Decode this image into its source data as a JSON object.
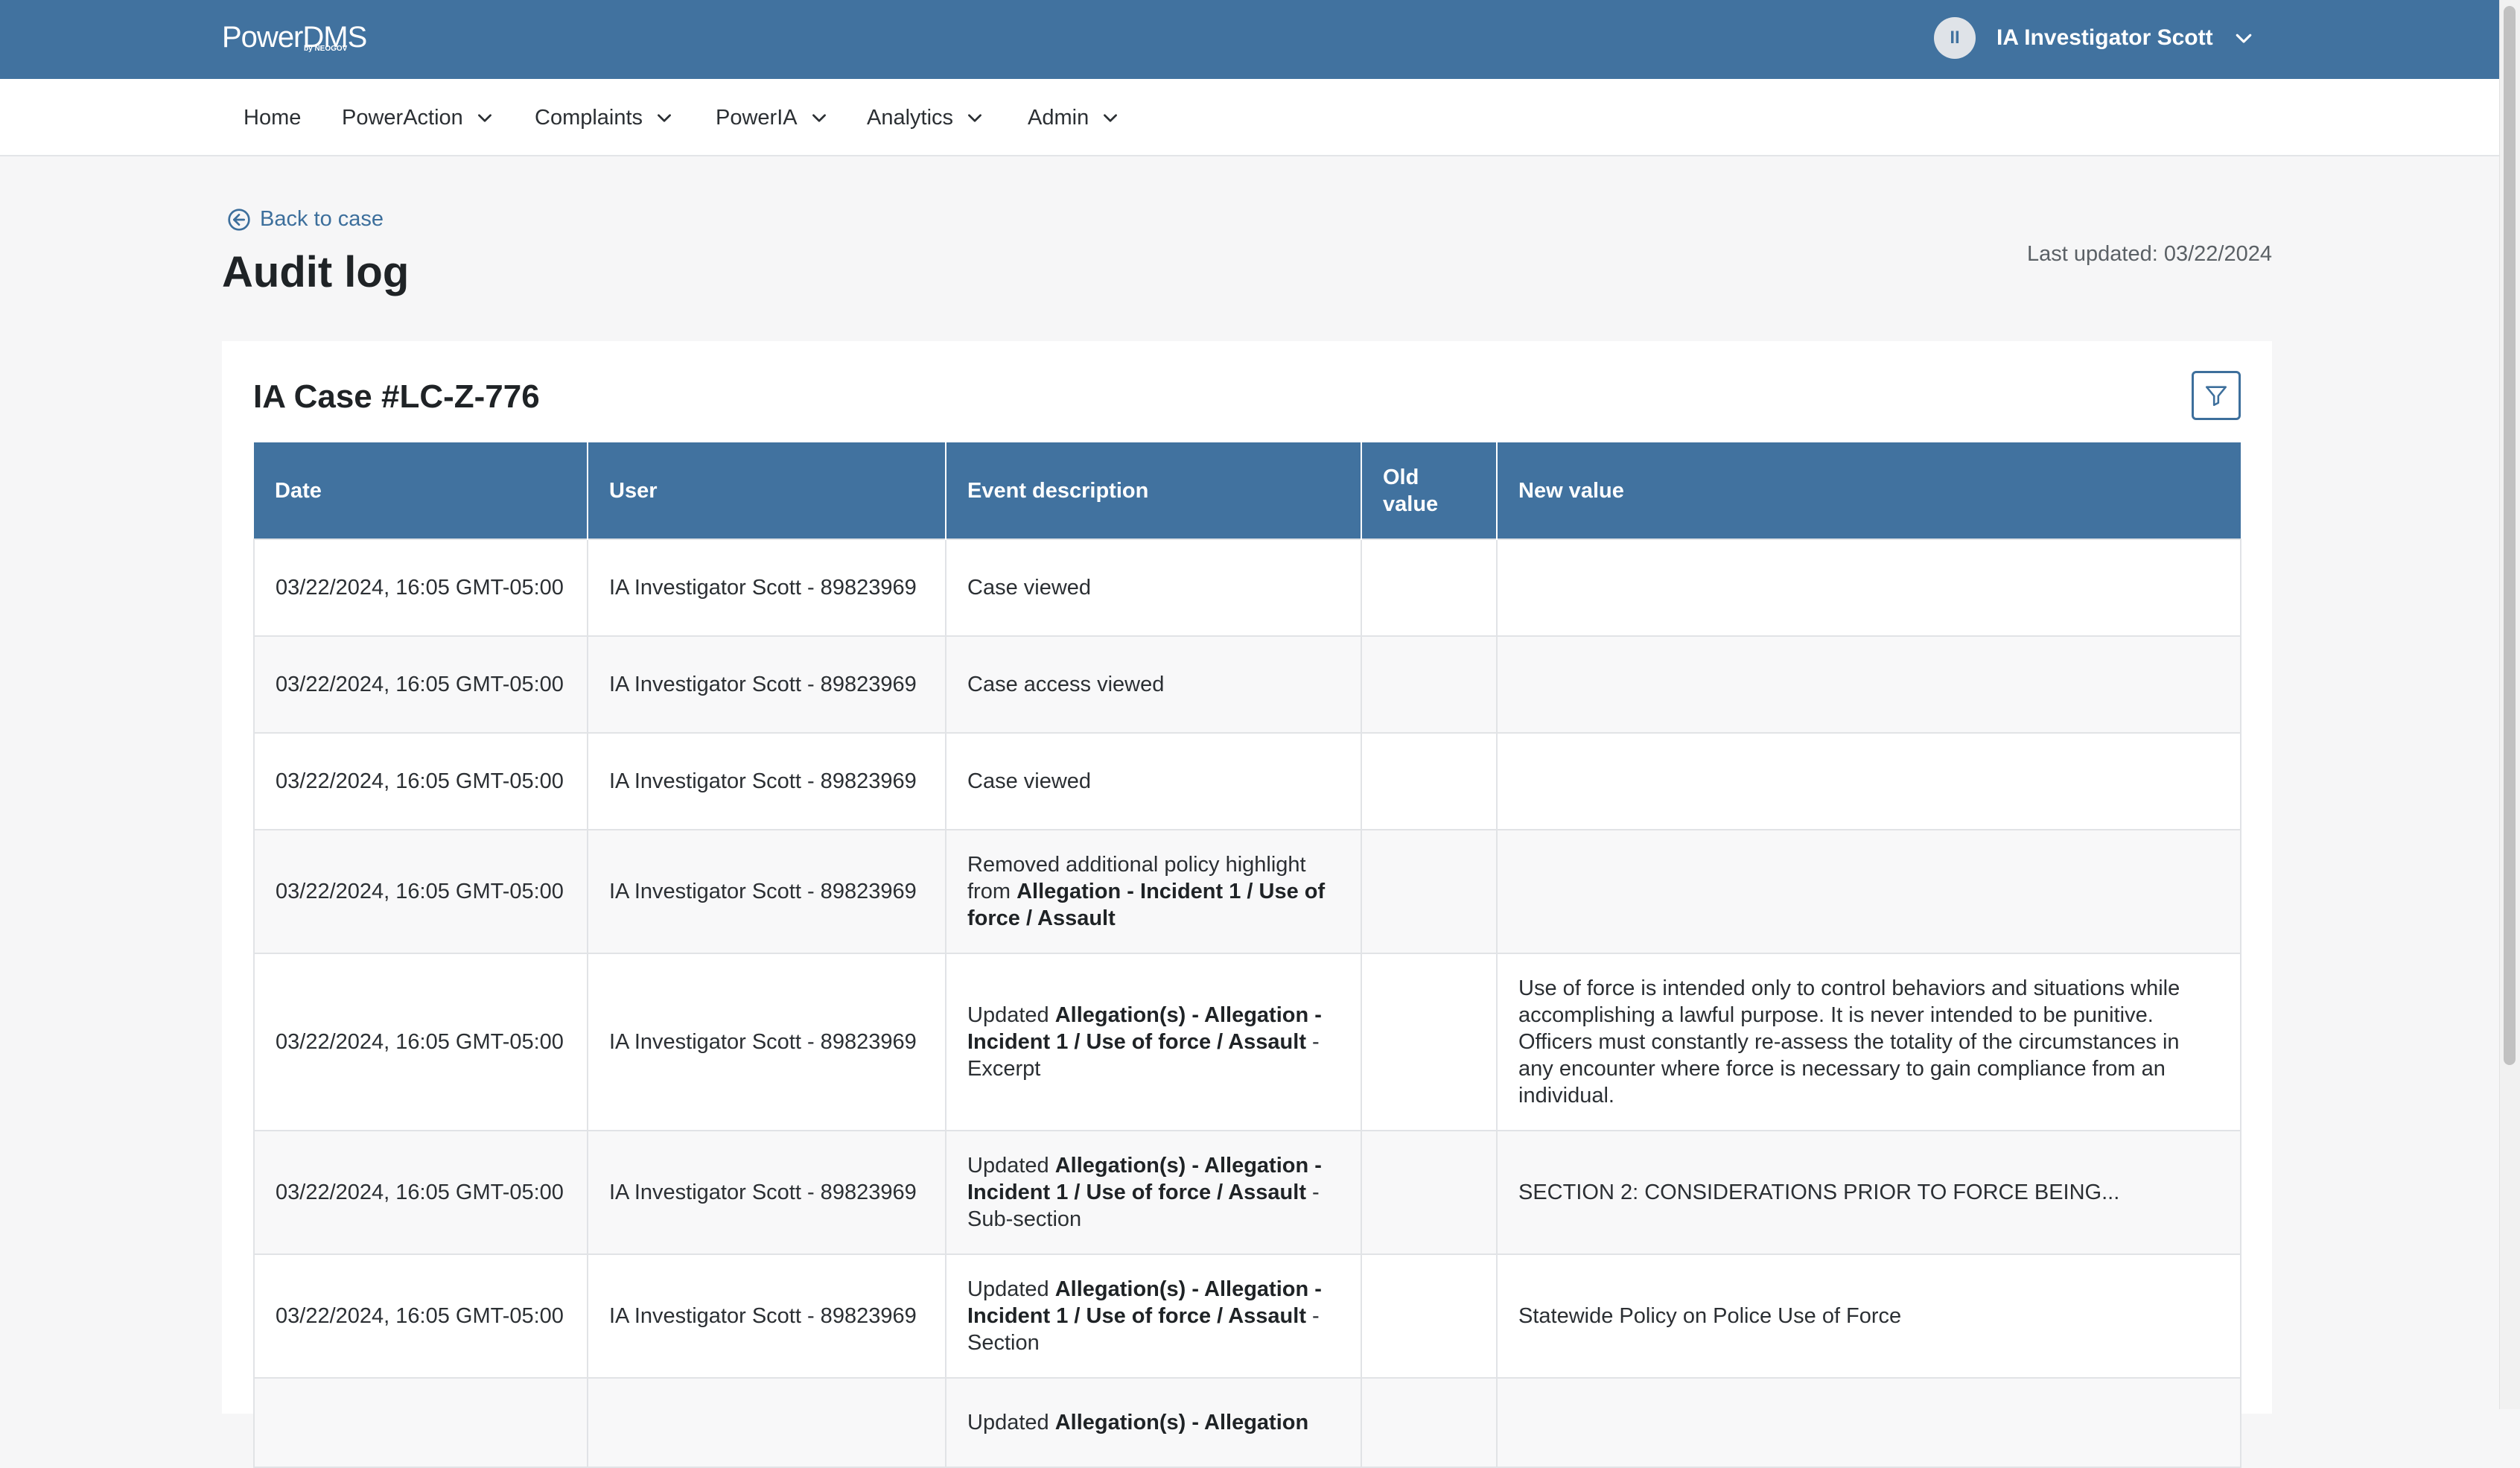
{
  "header": {
    "logo_text": "PowerDMS",
    "logo_sub": "by NEOGOV",
    "avatar_initials": "II",
    "user_name": "IA Investigator Scott"
  },
  "nav": {
    "items": [
      {
        "label": "Home",
        "has_dropdown": false
      },
      {
        "label": "PowerAction",
        "has_dropdown": true
      },
      {
        "label": "Complaints",
        "has_dropdown": true
      },
      {
        "label": "PowerIA",
        "has_dropdown": true
      },
      {
        "label": "Analytics",
        "has_dropdown": true
      },
      {
        "label": "Admin",
        "has_dropdown": true
      }
    ]
  },
  "page": {
    "back_label": "Back to case",
    "title": "Audit log",
    "last_updated": "Last updated: 03/22/2024"
  },
  "card": {
    "case_title": "IA Case #LC-Z-776"
  },
  "table": {
    "columns": [
      "Date",
      "User",
      "Event description",
      "Old value",
      "New value"
    ],
    "rows": [
      {
        "date": "03/22/2024, 16:05 GMT-05:00",
        "user": "IA Investigator Scott - 89823969",
        "event": [
          {
            "t": "Case viewed",
            "b": false
          }
        ],
        "old": "",
        "new": ""
      },
      {
        "date": "03/22/2024, 16:05 GMT-05:00",
        "user": "IA Investigator Scott - 89823969",
        "event": [
          {
            "t": "Case access viewed",
            "b": false
          }
        ],
        "old": "",
        "new": ""
      },
      {
        "date": "03/22/2024, 16:05 GMT-05:00",
        "user": "IA Investigator Scott - 89823969",
        "event": [
          {
            "t": "Case viewed",
            "b": false
          }
        ],
        "old": "",
        "new": ""
      },
      {
        "date": "03/22/2024, 16:05 GMT-05:00",
        "user": "IA Investigator Scott - 89823969",
        "event": [
          {
            "t": "Removed additional policy highlight from ",
            "b": false
          },
          {
            "t": "Allegation - Incident 1 / Use of force / Assault",
            "b": true
          }
        ],
        "old": "",
        "new": ""
      },
      {
        "date": "03/22/2024, 16:05 GMT-05:00",
        "user": "IA Investigator Scott - 89823969",
        "event": [
          {
            "t": "Updated ",
            "b": false
          },
          {
            "t": "Allegation(s) - Allegation - Incident 1 / Use of force / Assault",
            "b": true
          },
          {
            "t": " - Excerpt",
            "b": false
          }
        ],
        "old": "",
        "new": "Use of force is intended only to control behaviors and situations while accomplishing a lawful purpose. It is never intended to be punitive. Officers must constantly re-assess the totality of the circumstances in any encounter where force is necessary to gain compliance from an individual."
      },
      {
        "date": "03/22/2024, 16:05 GMT-05:00",
        "user": "IA Investigator Scott - 89823969",
        "event": [
          {
            "t": "Updated ",
            "b": false
          },
          {
            "t": "Allegation(s) - Allegation - Incident 1 / Use of force / Assault",
            "b": true
          },
          {
            "t": " - Sub-section",
            "b": false
          }
        ],
        "old": "",
        "new": "SECTION 2: CONSIDERATIONS PRIOR TO FORCE BEING..."
      },
      {
        "date": "03/22/2024, 16:05 GMT-05:00",
        "user": "IA Investigator Scott - 89823969",
        "event": [
          {
            "t": "Updated ",
            "b": false
          },
          {
            "t": "Allegation(s) - Allegation - Incident 1 / Use of force / Assault",
            "b": true
          },
          {
            "t": " - Section",
            "b": false
          }
        ],
        "old": "",
        "new": "Statewide Policy on Police Use of Force"
      },
      {
        "date": "",
        "user": "",
        "event": [
          {
            "t": "Updated ",
            "b": false
          },
          {
            "t": "Allegation(s) - Allegation",
            "b": true
          }
        ],
        "old": "",
        "new": ""
      }
    ]
  },
  "icons": {
    "chevron": "chevron-down-icon",
    "back": "arrow-left-circle-icon",
    "filter": "filter-icon"
  },
  "colors": {
    "brand": "#41729f",
    "link": "#3d6f9c"
  }
}
